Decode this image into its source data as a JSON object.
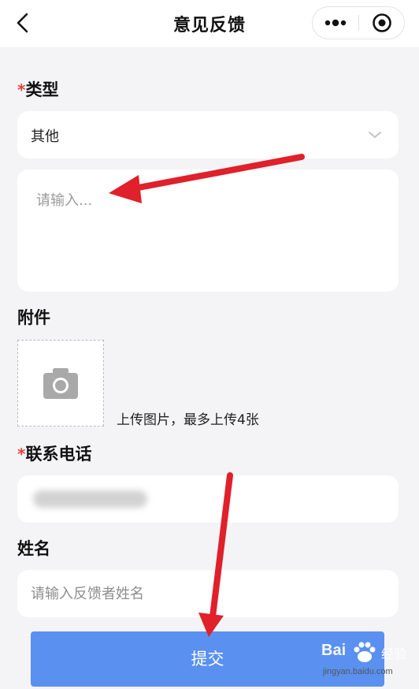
{
  "navbar": {
    "title": "意见反馈"
  },
  "form": {
    "type_label": "类型",
    "type_value": "其他",
    "description_placeholder": "请输入...",
    "attachment_label": "附件",
    "attachment_hint": "上传图片，最多上传4张",
    "phone_label": "联系电话",
    "name_label": "姓名",
    "name_placeholder": "请输入反馈者姓名",
    "required_mark": "*"
  },
  "submit_label": "提交",
  "watermark": {
    "brand": "Bai",
    "brand_suffix": "经验",
    "url": "jingyan.baidu.com"
  },
  "colors": {
    "required": "#e8413c",
    "submit_button": "#5a90f0",
    "annotation_arrow": "#e0202a",
    "page_background": "#f4f4f6"
  },
  "icons": {
    "back": "chevron-left-icon",
    "more": "more-dots-icon",
    "close": "target-circle-icon",
    "dropdown": "chevron-down-icon",
    "upload": "camera-icon"
  }
}
